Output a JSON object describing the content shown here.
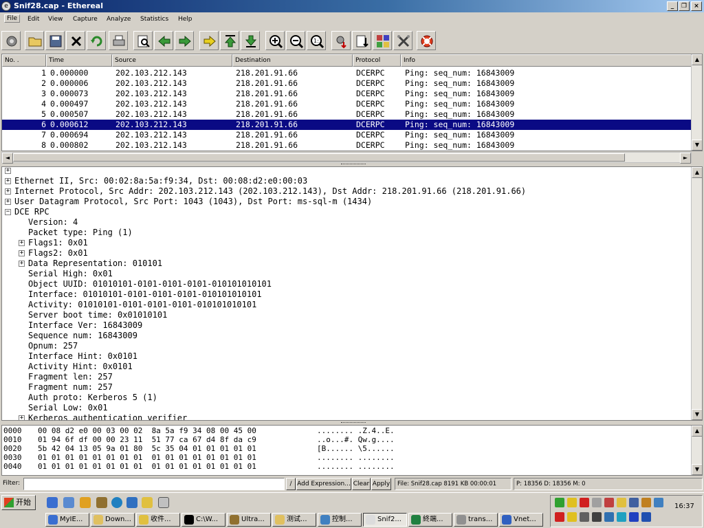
{
  "window": {
    "title": "Snif28.cap - Ethereal",
    "icon": "ethereal-app-icon"
  },
  "menu": [
    "File",
    "Edit",
    "View",
    "Capture",
    "Analyze",
    "Statistics",
    "Help"
  ],
  "toolbar": [
    "interfaces-icon",
    "open-folder-icon",
    "save-icon",
    "close-x-icon",
    "reload-icon",
    "print-icon",
    "find-icon",
    "back-arrow-icon",
    "forward-arrow-icon",
    "goto-packet-icon",
    "first-packet-icon",
    "last-packet-icon",
    "zoom-in-icon",
    "zoom-out-icon",
    "zoom-normal-icon",
    "capture-filter-icon",
    "display-filter-icon",
    "coloring-rules-icon",
    "preferences-icon",
    "help-lifebuoy-icon"
  ],
  "packet_list": {
    "columns": [
      "No. .",
      "Time",
      "Source",
      "Destination",
      "Protocol",
      "Info"
    ],
    "rows": [
      {
        "no": "1",
        "time": "0.000000",
        "src": "202.103.212.143",
        "dst": "218.201.91.66",
        "proto": "DCERPC",
        "info": "Ping: seq_num: 16843009",
        "selected": false
      },
      {
        "no": "2",
        "time": "0.000006",
        "src": "202.103.212.143",
        "dst": "218.201.91.66",
        "proto": "DCERPC",
        "info": "Ping: seq_num: 16843009",
        "selected": false
      },
      {
        "no": "3",
        "time": "0.000073",
        "src": "202.103.212.143",
        "dst": "218.201.91.66",
        "proto": "DCERPC",
        "info": "Ping: seq_num: 16843009",
        "selected": false
      },
      {
        "no": "4",
        "time": "0.000497",
        "src": "202.103.212.143",
        "dst": "218.201.91.66",
        "proto": "DCERPC",
        "info": "Ping: seq_num: 16843009",
        "selected": false
      },
      {
        "no": "5",
        "time": "0.000507",
        "src": "202.103.212.143",
        "dst": "218.201.91.66",
        "proto": "DCERPC",
        "info": "Ping: seq_num: 16843009",
        "selected": false
      },
      {
        "no": "6",
        "time": "0.000612",
        "src": "202.103.212.143",
        "dst": "218.201.91.66",
        "proto": "DCERPC",
        "info": "Ping: seq_num: 16843009",
        "selected": true
      },
      {
        "no": "7",
        "time": "0.000694",
        "src": "202.103.212.143",
        "dst": "218.201.91.66",
        "proto": "DCERPC",
        "info": "Ping: seq_num: 16843009",
        "selected": false
      },
      {
        "no": "8",
        "time": "0.000802",
        "src": "202.103.212.143",
        "dst": "218.201.91.66",
        "proto": "DCERPC",
        "info": "Ping: seq_num: 16843009",
        "selected": false
      }
    ]
  },
  "detail_tree": [
    {
      "level": 0,
      "expander": "+",
      "text": ""
    },
    {
      "level": 0,
      "expander": "+",
      "text": "Ethernet II, Src: 00:02:8a:5a:f9:34, Dst: 00:08:d2:e0:00:03"
    },
    {
      "level": 0,
      "expander": "+",
      "text": "Internet Protocol, Src Addr: 202.103.212.143 (202.103.212.143), Dst Addr: 218.201.91.66 (218.201.91.66)"
    },
    {
      "level": 0,
      "expander": "+",
      "text": "User Datagram Protocol, Src Port: 1043 (1043), Dst Port: ms-sql-m (1434)"
    },
    {
      "level": 0,
      "expander": "-",
      "text": "DCE RPC"
    },
    {
      "level": 1,
      "expander": "",
      "text": "Version: 4"
    },
    {
      "level": 1,
      "expander": "",
      "text": "Packet type: Ping (1)"
    },
    {
      "level": 1,
      "expander": "+",
      "text": "Flags1: 0x01"
    },
    {
      "level": 1,
      "expander": "+",
      "text": "Flags2: 0x01"
    },
    {
      "level": 1,
      "expander": "+",
      "text": "Data Representation: 010101"
    },
    {
      "level": 1,
      "expander": "",
      "text": "Serial High: 0x01"
    },
    {
      "level": 1,
      "expander": "",
      "text": "Object UUID: 01010101-0101-0101-0101-010101010101"
    },
    {
      "level": 1,
      "expander": "",
      "text": "Interface: 01010101-0101-0101-0101-010101010101"
    },
    {
      "level": 1,
      "expander": "",
      "text": "Activity: 01010101-0101-0101-0101-010101010101"
    },
    {
      "level": 1,
      "expander": "",
      "text": "Server boot time: 0x01010101"
    },
    {
      "level": 1,
      "expander": "",
      "text": "Interface Ver: 16843009"
    },
    {
      "level": 1,
      "expander": "",
      "text": "Sequence num: 16843009"
    },
    {
      "level": 1,
      "expander": "",
      "text": "Opnum: 257"
    },
    {
      "level": 1,
      "expander": "",
      "text": "Interface Hint: 0x0101"
    },
    {
      "level": 1,
      "expander": "",
      "text": "Activity Hint: 0x0101"
    },
    {
      "level": 1,
      "expander": "",
      "text": "Fragment len: 257"
    },
    {
      "level": 1,
      "expander": "",
      "text": "Fragment num: 257"
    },
    {
      "level": 1,
      "expander": "",
      "text": "Auth proto: Kerberos 5 (1)"
    },
    {
      "level": 1,
      "expander": "",
      "text": "Serial Low: 0x01"
    },
    {
      "level": 1,
      "expander": "+",
      "text": "Kerberos authentication verifier"
    }
  ],
  "hex_dump": [
    {
      "offset": "0000",
      "bytes": "00 08 d2 e0 00 03 00 02  8a 5a f9 34 08 00 45 00",
      "ascii": "........ .Z.4..E."
    },
    {
      "offset": "0010",
      "bytes": "01 94 6f df 00 00 23 11  51 77 ca 67 d4 8f da c9",
      "ascii": "..o...#. Qw.g...."
    },
    {
      "offset": "0020",
      "bytes": "5b 42 04 13 05 9a 01 80  5c 35 04 01 01 01 01 01",
      "ascii": "[B...... \\5......"
    },
    {
      "offset": "0030",
      "bytes": "01 01 01 01 01 01 01 01  01 01 01 01 01 01 01 01",
      "ascii": "........ ........"
    },
    {
      "offset": "0040",
      "bytes": "01 01 01 01 01 01 01 01  01 01 01 01 01 01 01 01",
      "ascii": "........ ........"
    },
    {
      "offset": "",
      "bytes": "",
      "ascii": ""
    }
  ],
  "filter_bar": {
    "label": "Filter:",
    "value": "",
    "slash_button": "/",
    "add_expression": "Add Expression...",
    "clear": "Clear",
    "apply": "Apply",
    "status_file": "File: Snif28.cap 8191 KB 00:00:01",
    "status_packets": "P: 18356 D: 18356 M: 0"
  },
  "taskbar": {
    "start_label": "开始",
    "clock": "16:37",
    "tasks": [
      {
        "label": "MyIE...",
        "icon": "ie-icon",
        "pressed": false
      },
      {
        "label": "Down...",
        "icon": "folder-icon",
        "pressed": false
      },
      {
        "label": "收件...",
        "icon": "mail-icon",
        "pressed": false
      },
      {
        "label": "C:\\W...",
        "icon": "cmd-icon",
        "pressed": false
      },
      {
        "label": "Ultra...",
        "icon": "ultraedit-icon",
        "pressed": false
      },
      {
        "label": "测试...",
        "icon": "folder-icon",
        "pressed": false
      },
      {
        "label": "控制...",
        "icon": "control-panel-icon",
        "pressed": false
      },
      {
        "label": "Snif2...",
        "icon": "ethereal-app-icon",
        "pressed": true
      },
      {
        "label": "終端...",
        "icon": "terminal-icon",
        "pressed": false
      },
      {
        "label": "trans...",
        "icon": "transfer-icon",
        "pressed": false
      },
      {
        "label": "Vnet...",
        "icon": "vnet-icon",
        "pressed": false
      }
    ]
  },
  "colors": {
    "selection": "#0a0a84",
    "titlebar_start": "#0a246a",
    "titlebar_end": "#a6caf0",
    "chrome": "#d4d0c8"
  }
}
